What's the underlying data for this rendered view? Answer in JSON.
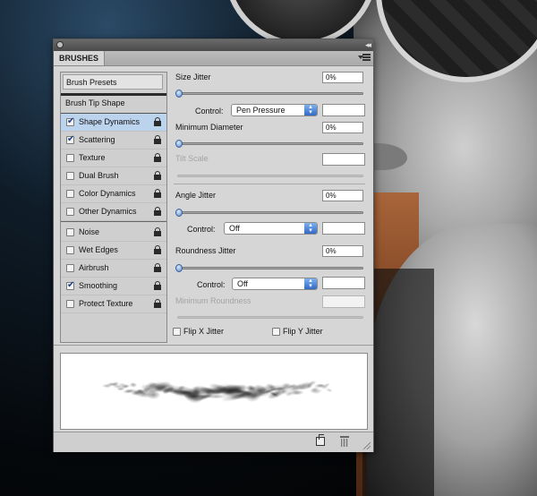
{
  "panel": {
    "tab_label": "BRUSHES",
    "brush_presets_label": "Brush Presets",
    "brush_tip_shape_label": "Brush Tip Shape"
  },
  "options": [
    {
      "label": "Shape Dynamics",
      "checked": true,
      "selected": true,
      "lockable": true
    },
    {
      "label": "Scattering",
      "checked": true,
      "selected": false,
      "lockable": true
    },
    {
      "label": "Texture",
      "checked": false,
      "selected": false,
      "lockable": true
    },
    {
      "label": "Dual Brush",
      "checked": false,
      "selected": false,
      "lockable": true
    },
    {
      "label": "Color Dynamics",
      "checked": false,
      "selected": false,
      "lockable": true
    },
    {
      "label": "Other Dynamics",
      "checked": false,
      "selected": false,
      "lockable": true
    },
    {
      "label": "Noise",
      "checked": false,
      "selected": false,
      "lockable": true
    },
    {
      "label": "Wet Edges",
      "checked": false,
      "selected": false,
      "lockable": true
    },
    {
      "label": "Airbrush",
      "checked": false,
      "selected": false,
      "lockable": true
    },
    {
      "label": "Smoothing",
      "checked": true,
      "selected": false,
      "lockable": true
    },
    {
      "label": "Protect Texture",
      "checked": false,
      "selected": false,
      "lockable": true
    }
  ],
  "settings": {
    "size_jitter": {
      "label": "Size Jitter",
      "value": "0%",
      "slider_fraction": 0
    },
    "size_control": {
      "label": "Control:",
      "value": "Pen Pressure"
    },
    "min_diameter": {
      "label": "Minimum Diameter",
      "value": "0%",
      "slider_fraction": 0
    },
    "tilt_scale": {
      "label": "Tilt Scale"
    },
    "angle_jitter": {
      "label": "Angle Jitter",
      "value": "0%",
      "slider_fraction": 0
    },
    "angle_control": {
      "label": "Control:",
      "value": "Off"
    },
    "roundness_jitter": {
      "label": "Roundness Jitter",
      "value": "0%",
      "slider_fraction": 0
    },
    "roundness_control": {
      "label": "Control:",
      "value": "Off"
    },
    "min_roundness": {
      "label": "Minimum Roundness"
    },
    "flip_x": {
      "label": "Flip X Jitter",
      "checked": false
    },
    "flip_y": {
      "label": "Flip Y Jitter",
      "checked": false
    }
  },
  "colors": {
    "selection": "#bcd3ee",
    "slider_knob": "#5c8fd4",
    "panel_bg": "#d6d6d6"
  }
}
